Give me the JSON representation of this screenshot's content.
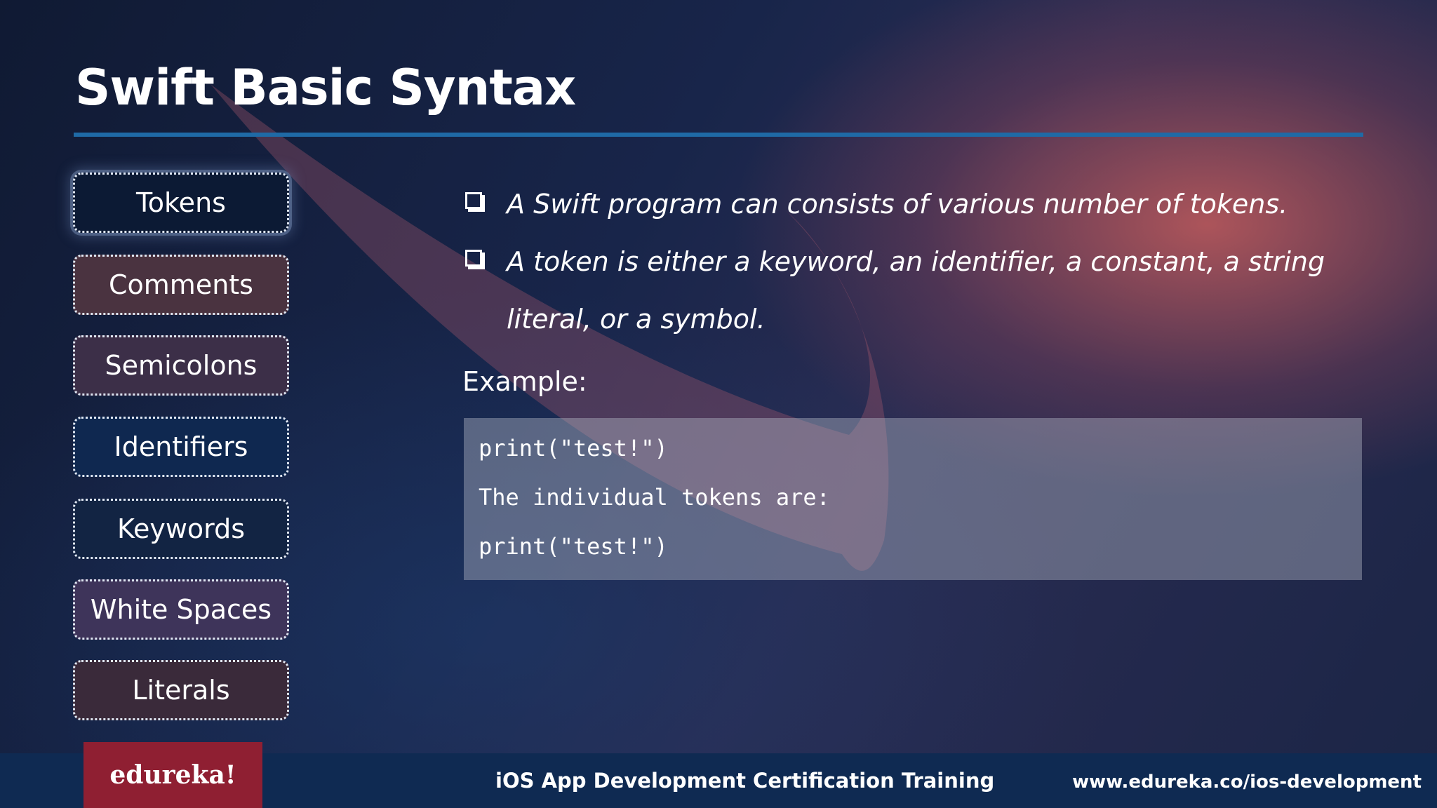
{
  "slide": {
    "title": "Swift Basic Syntax"
  },
  "nav": {
    "items": [
      {
        "label": "Tokens",
        "active": true,
        "fill": "#0c1a34"
      },
      {
        "label": "Comments",
        "active": false,
        "fill": "#4a3340"
      },
      {
        "label": "Semicolons",
        "active": false,
        "fill": "#3c2f48"
      },
      {
        "label": "Identifiers",
        "active": false,
        "fill": "#0f2850"
      },
      {
        "label": "Keywords",
        "active": false,
        "fill": "#122443"
      },
      {
        "label": "White Spaces",
        "active": false,
        "fill": "#3e345a"
      },
      {
        "label": "Literals",
        "active": false,
        "fill": "#3a2a3a"
      }
    ]
  },
  "content": {
    "bullets": [
      "A Swift program can consists of various number of tokens.",
      "A token is either a keyword, an identifier, a constant, a string literal, or a symbol."
    ],
    "example_label": "Example:",
    "code_lines": [
      "print(\"test!\")",
      "The individual tokens are:",
      "print(\"test!\")"
    ]
  },
  "footer": {
    "logo_text": "edureka!",
    "course": "iOS App Development Certification Training",
    "url": "www.edureka.co/ios-development"
  },
  "colors": {
    "accent_rule": "#1f6aa6",
    "footer_bg": "#0f2a52",
    "logo_bg": "#8f1f32"
  },
  "icons": {
    "background": "swift-bird-logo",
    "bullet": "checkbox-icon"
  }
}
